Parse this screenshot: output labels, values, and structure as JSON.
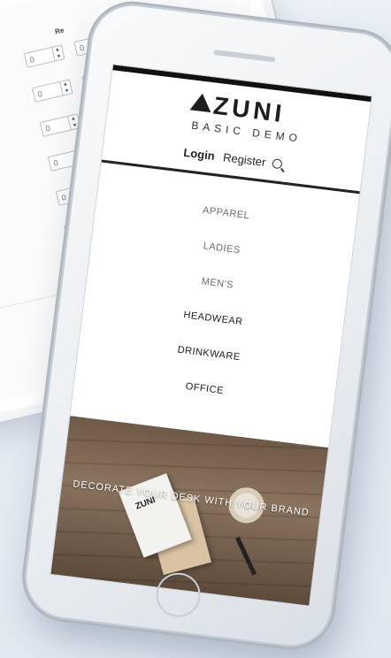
{
  "tablet": {
    "column_header": "Re",
    "spinner_value": "0",
    "rows": 6
  },
  "brand": {
    "logo": "ZUNI",
    "subtitle": "BASIC DEMO"
  },
  "auth": {
    "login": "Login",
    "register": "Register"
  },
  "menu": [
    {
      "label": "APPAREL",
      "tone": "light"
    },
    {
      "label": "LADIES",
      "tone": "light"
    },
    {
      "label": "MEN'S",
      "tone": "light"
    },
    {
      "label": "HEADWEAR",
      "tone": "dark"
    },
    {
      "label": "DRINKWARE",
      "tone": "dark"
    },
    {
      "label": "OFFICE",
      "tone": "dark"
    }
  ],
  "hero": {
    "headline": "DECORATE YOUR DESK WITH YOUR BRAND",
    "card_text": "ZUNI"
  },
  "icons": {
    "search": "search-icon",
    "logo": "triangle-logo-icon"
  }
}
